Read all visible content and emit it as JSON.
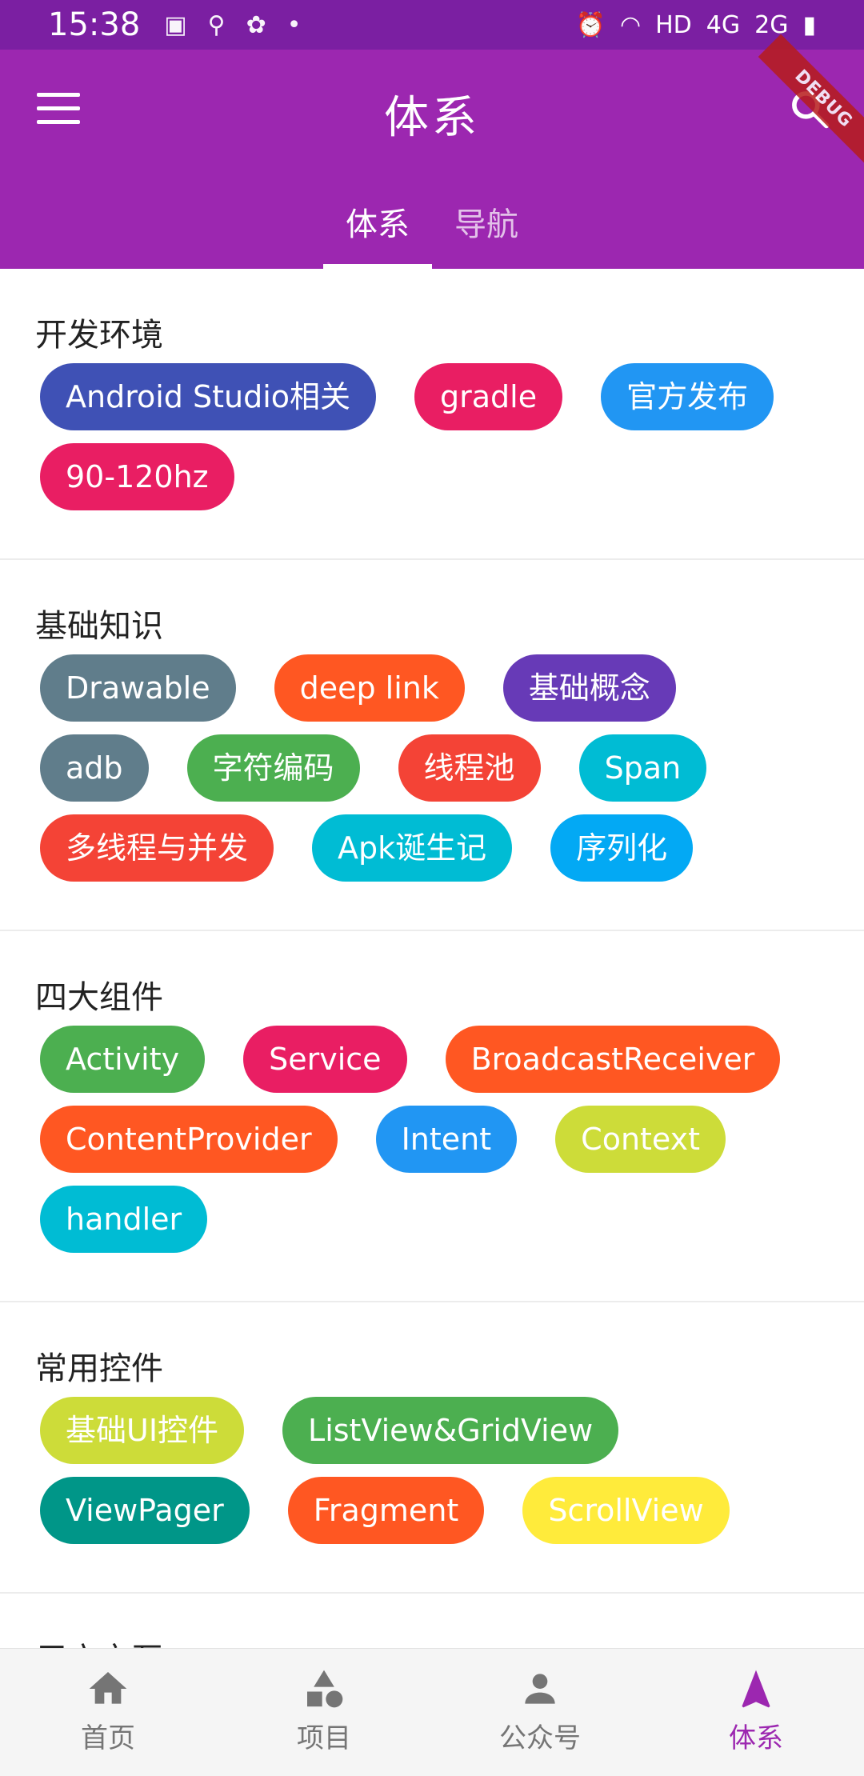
{
  "status_bar": {
    "time": "15:38",
    "left_icons": [
      "image-icon",
      "search-icon",
      "bug-icon",
      "dot-icon"
    ],
    "right_text": [
      "⏰",
      "HD",
      "4G",
      "2G"
    ]
  },
  "app_bar": {
    "title": "体系",
    "menu_icon": "menu-icon",
    "search_icon": "search-icon",
    "debug_banner": "DEBUG"
  },
  "tabs": [
    {
      "label": "体系",
      "active": true
    },
    {
      "label": "导航",
      "active": false
    }
  ],
  "sections": [
    {
      "title": "开发环境",
      "chips": [
        {
          "label": "Android Studio相关",
          "color": "#3f51b5"
        },
        {
          "label": "gradle",
          "color": "#e91e63"
        },
        {
          "label": "官方发布",
          "color": "#2196f3"
        },
        {
          "label": "90-120hz",
          "color": "#e91e63"
        }
      ]
    },
    {
      "title": "基础知识",
      "chips": [
        {
          "label": "Drawable",
          "color": "#607d8b"
        },
        {
          "label": "deep link",
          "color": "#ff5722"
        },
        {
          "label": "基础概念",
          "color": "#673ab7"
        },
        {
          "label": "adb",
          "color": "#607d8b"
        },
        {
          "label": "字符编码",
          "color": "#4caf50"
        },
        {
          "label": "线程池",
          "color": "#f44336"
        },
        {
          "label": "Span",
          "color": "#00bcd4"
        },
        {
          "label": "多线程与并发",
          "color": "#f44336"
        },
        {
          "label": "Apk诞生记",
          "color": "#00bcd4"
        },
        {
          "label": "序列化",
          "color": "#03a9f4"
        }
      ]
    },
    {
      "title": "四大组件",
      "chips": [
        {
          "label": "Activity",
          "color": "#4caf50"
        },
        {
          "label": "Service",
          "color": "#e91e63"
        },
        {
          "label": "BroadcastReceiver",
          "color": "#ff5722"
        },
        {
          "label": "ContentProvider",
          "color": "#ff5722"
        },
        {
          "label": "Intent",
          "color": "#2196f3"
        },
        {
          "label": "Context",
          "color": "#cddc39"
        },
        {
          "label": "handler",
          "color": "#00bcd4"
        }
      ]
    },
    {
      "title": "常用控件",
      "chips": [
        {
          "label": "基础UI控件",
          "color": "#cddc39"
        },
        {
          "label": "ListView&GridView",
          "color": "#4caf50"
        },
        {
          "label": "ViewPager",
          "color": "#009688"
        },
        {
          "label": "Fragment",
          "color": "#ff5722"
        },
        {
          "label": "ScrollView",
          "color": "#ffeb3b"
        }
      ]
    },
    {
      "title": "用户交互",
      "chips": [
        {
          "label": "",
          "color": "#3f51b5"
        },
        {
          "label": "",
          "color": "#03a9f4"
        },
        {
          "label": "",
          "color": "#cddc39"
        }
      ]
    }
  ],
  "bottom_nav": [
    {
      "label": "首页",
      "icon": "home-icon",
      "active": false
    },
    {
      "label": "项目",
      "icon": "shapes-icon",
      "active": false
    },
    {
      "label": "公众号",
      "icon": "person-icon",
      "active": false
    },
    {
      "label": "体系",
      "icon": "navigation-arrow-icon",
      "active": true
    }
  ],
  "colors": {
    "primary": "#9c27b0",
    "primary_dark": "#7b1fa2",
    "nav_active": "#9c27b0",
    "nav_inactive": "#757575"
  }
}
